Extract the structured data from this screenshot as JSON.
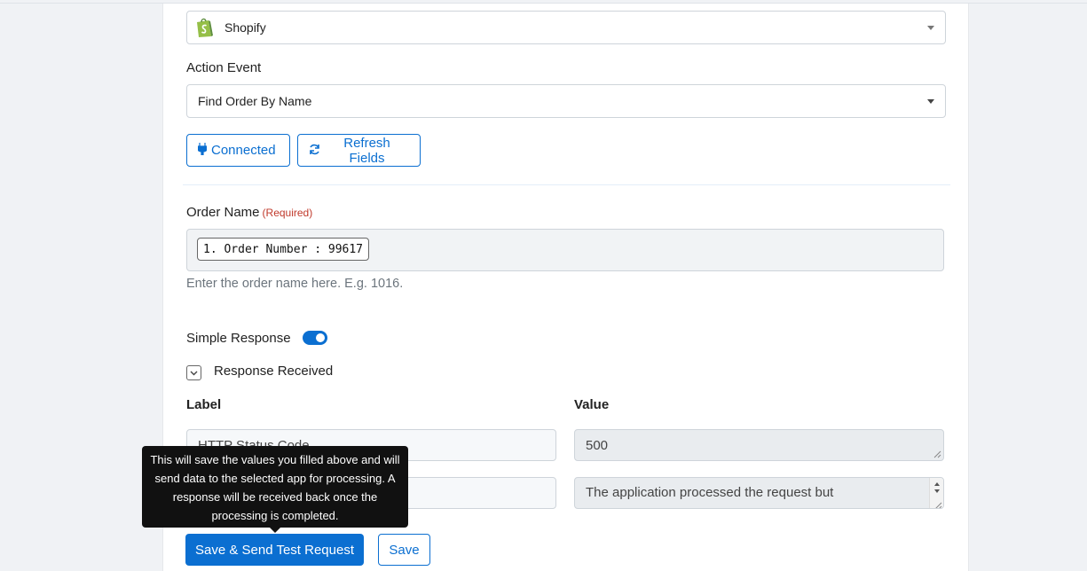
{
  "app_select": {
    "value": "Shopify",
    "logo_icon": "shopify-bag-icon"
  },
  "action_event": {
    "label": "Action Event",
    "value": "Find Order By Name"
  },
  "buttons": {
    "connected": "Connected",
    "refresh_fields": "Refresh Fields",
    "save_send": "Save & Send Test Request",
    "save": "Save"
  },
  "order_name": {
    "label": "Order Name",
    "required": "(Required)",
    "chip": "1. Order Number : 99617",
    "help": "Enter the order name here. E.g. 1016."
  },
  "simple_response": {
    "label": "Simple Response",
    "enabled": true
  },
  "response_received": {
    "label": "Response Received"
  },
  "table": {
    "label_header": "Label",
    "value_header": "Value",
    "rows": [
      {
        "label": "HTTP Status Code",
        "value": "500"
      },
      {
        "label": "",
        "value": "The application processed the request but"
      }
    ]
  },
  "tooltip": {
    "text": "This will save the values you filled above and will send data to the selected app for processing. A response will be received back once the processing is completed."
  },
  "colors": {
    "accent": "#0b6fd1",
    "required": "#c0392b",
    "shopify_green": "#95bf47"
  }
}
